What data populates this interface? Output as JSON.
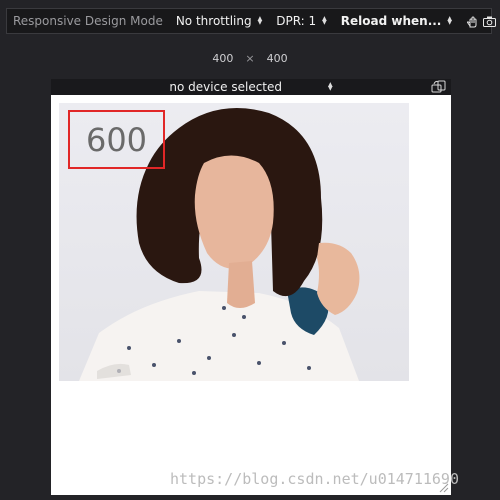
{
  "toolbar": {
    "title": "Responsive Design Mode",
    "throttling": "No throttling",
    "dpr": "DPR: 1",
    "reload": "Reload when...",
    "icons": [
      "touch-icon",
      "camera-icon",
      "close-icon"
    ]
  },
  "viewport_size": {
    "width": "400",
    "separator": "×",
    "height": "400"
  },
  "device_bar": {
    "selected": "no device selected",
    "rotate_icon": "rotate-device-icon"
  },
  "annotation": {
    "label": "600",
    "border_color": "#e12727"
  },
  "watermark": "https://blog.csdn.net/u014711690",
  "colors": {
    "chrome_bg": "#232327",
    "toolbar_bg": "#18181a",
    "viewport_bg": "#ffffff"
  }
}
